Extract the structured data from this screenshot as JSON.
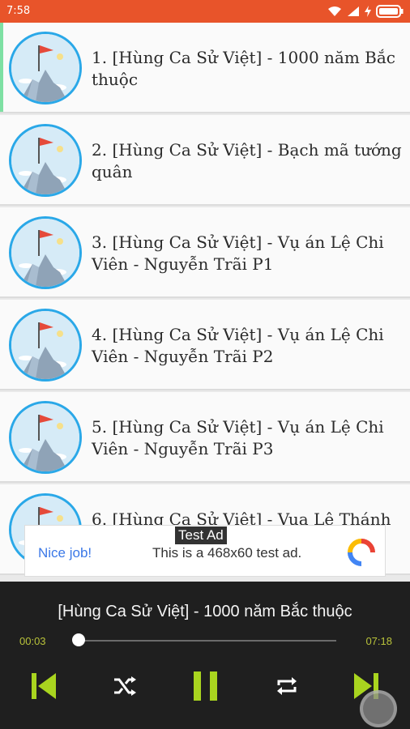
{
  "status_bar": {
    "time": "7:58"
  },
  "playlist": {
    "items": [
      {
        "label": "1. [Hùng Ca Sử Việt] - 1000 năm Bắc thuộc",
        "active": true
      },
      {
        "label": "2. [Hùng Ca Sử Việt] - Bạch mã tướng quân"
      },
      {
        "label": "3. [Hùng Ca Sử Việt] - Vụ án Lệ Chi Viên - Nguyễn Trãi P1"
      },
      {
        "label": "4. [Hùng Ca Sử Việt] - Vụ án Lệ Chi Viên - Nguyễn Trãi P2"
      },
      {
        "label": "5. [Hùng Ca Sử Việt] - Vụ án Lệ Chi Viên - Nguyễn Trãi P3"
      },
      {
        "label": "6. [Hùng Ca Sử Việt] - Vua Lê Thánh"
      }
    ]
  },
  "ad": {
    "tag": "Test Ad",
    "nice": "Nice job!",
    "text": "This is a 468x60 test ad."
  },
  "player": {
    "now_playing": "[Hùng Ca Sử Việt] - 1000 năm Bắc thuộc",
    "current_time": "00:03",
    "total_time": "07:18",
    "progress": 0.0068,
    "accent_color": "#a9d51f",
    "icons": [
      "skip-previous-icon",
      "shuffle-icon",
      "pause-icon",
      "repeat-icon",
      "skip-next-icon"
    ]
  }
}
